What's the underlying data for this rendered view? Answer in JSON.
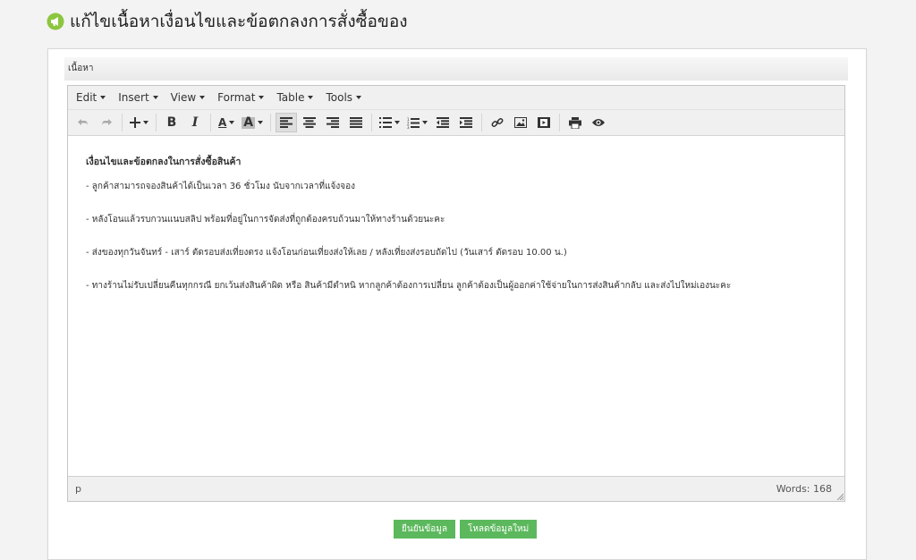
{
  "header": {
    "title": "แก้ไขเนื้อหาเงื่อนไขและข้อตกลงการสั่งซื้อของ",
    "icon": "megaphone-icon"
  },
  "panel": {
    "heading": "เนื้อหา"
  },
  "menu": {
    "edit": "Edit",
    "insert": "Insert",
    "view": "View",
    "format": "Format",
    "table": "Table",
    "tools": "Tools"
  },
  "toolbar": {
    "bold": "B",
    "italic": "I",
    "font_color": "A",
    "bg_color": "A"
  },
  "content": {
    "heading": "เงื่อนไขและข้อตกลงในการสั่งซื้อสินค้า",
    "lines": [
      "- ลูกค้าสามารถจองสินค้าได้เป็นเวลา 36 ชั่วโมง นับจากเวลาที่แจ้งจอง",
      "- หลังโอนแล้วรบกวนแนบสลิป พร้อมที่อยู่ในการจัดส่งที่ถูกต้องครบถ้วนมาให้ทางร้านด้วยนะคะ",
      "- ส่งของทุกวันจันทร์ - เสาร์ ตัดรอบส่งเที่ยงตรง แจ้งโอนก่อนเที่ยงส่งให้เลย / หลังเที่ยงส่งรอบถัดไป (วันเสาร์ ตัดรอบ 10.00 น.)",
      "- ทางร้านไม่รับเปลี่ยนคืนทุกกรณี ยกเว้นส่งสินค้าผิด หรือ สินค้ามีตำหนิ หากลูกค้าต้องการเปลี่ยน ลูกค้าต้องเป็นผู้ออกค่าใช้จ่ายในการส่งสินค้ากลับ และส่งไปใหม่เองนะคะ"
    ]
  },
  "status": {
    "path": "p",
    "words": "Words: 168"
  },
  "buttons": {
    "save": "ยืนยันข้อมูล",
    "reload": "โหลดข้อมูลใหม่"
  },
  "colors": {
    "accent_green": "#5cb85c",
    "icon_green": "#8cc63f"
  }
}
